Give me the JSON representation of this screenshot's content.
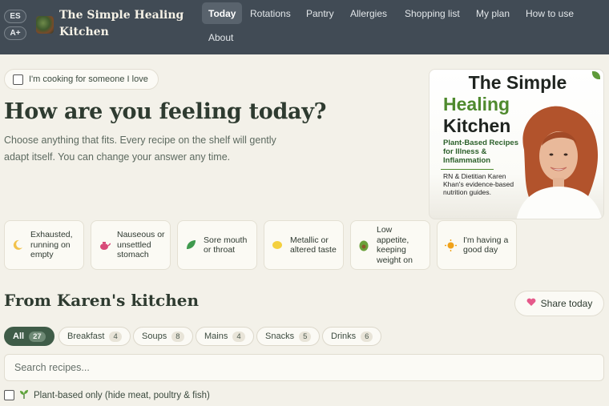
{
  "header": {
    "lang_button": "ES",
    "font_button": "A+",
    "brand": "The Simple Healing Kitchen",
    "nav": [
      {
        "label": "Today",
        "active": true
      },
      {
        "label": "Rotations"
      },
      {
        "label": "Pantry"
      },
      {
        "label": "Allergies"
      },
      {
        "label": "Shopping list"
      },
      {
        "label": "My plan"
      },
      {
        "label": "How to use"
      },
      {
        "label": "About"
      }
    ]
  },
  "caregiver_toggle": {
    "label": "I'm cooking for someone I love",
    "checked": false
  },
  "hero": {
    "title": "How are you feeling today?",
    "subtitle": "Choose anything that fits. Every recipe on the shelf will gently adapt itself. You can change your answer any time."
  },
  "book": {
    "title_line1": "The Simple",
    "title_line2": "Healing",
    "title_line3": "Kitchen",
    "subtitle": "Plant-Based Recipes for Illness & Inflammation",
    "byline": "RN & Dietitian Karen Khan's evidence-based nutrition guides."
  },
  "moods": [
    {
      "label": "Exhausted, running on empty",
      "icon": "crescent-moon-icon"
    },
    {
      "label": "Nauseous or unsettled stomach",
      "icon": "teapot-icon"
    },
    {
      "label": "Sore mouth or throat",
      "icon": "leaf-icon"
    },
    {
      "label": "Metallic or altered taste",
      "icon": "lemon-icon"
    },
    {
      "label": "Low appetite, keeping weight on",
      "icon": "avocado-icon"
    },
    {
      "label": "I'm having a good day",
      "icon": "sun-icon"
    }
  ],
  "kitchen": {
    "title": "From Karen's kitchen",
    "share_label": "Share today",
    "categories": [
      {
        "label": "All",
        "count": "27",
        "active": true
      },
      {
        "label": "Breakfast",
        "count": "4"
      },
      {
        "label": "Soups",
        "count": "8"
      },
      {
        "label": "Mains",
        "count": "4"
      },
      {
        "label": "Snacks",
        "count": "5"
      },
      {
        "label": "Drinks",
        "count": "6"
      }
    ],
    "search_placeholder": "Search recipes...",
    "plant_based_label": "Plant-based only (hide meat, poultry & fish)",
    "plant_based_checked": false
  },
  "colors": {
    "header_bg": "#414b55",
    "page_bg": "#f3f1e9",
    "accent_green": "#3f5c48",
    "book_green": "#4f8a2e"
  }
}
